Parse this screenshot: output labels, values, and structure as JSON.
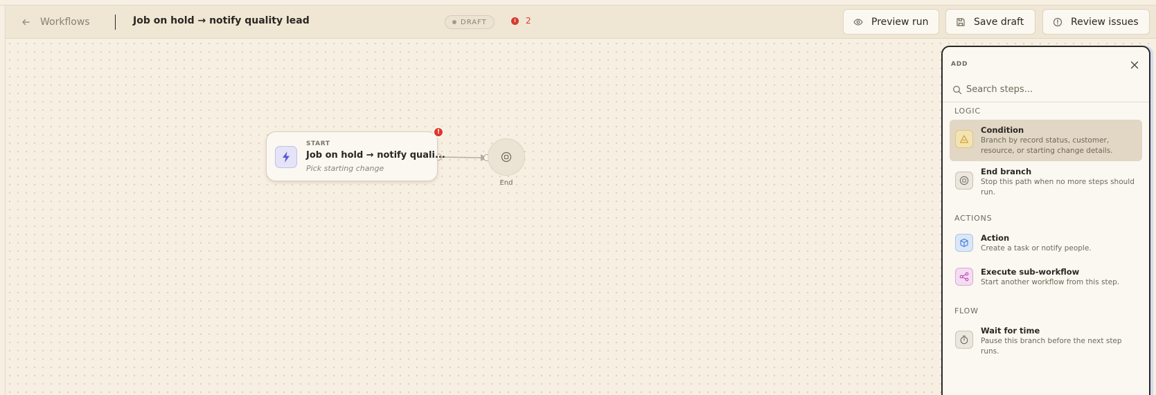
{
  "topbar": {
    "back_label": "Workflows",
    "workflow_title": "Job on hold → notify quality lead",
    "status_badge": "DRAFT",
    "issue_count": "2",
    "buttons": {
      "preview": "Preview run",
      "save": "Save draft",
      "review": "Review issues"
    }
  },
  "canvas": {
    "start_node": {
      "kicker": "START",
      "title": "Job on hold → notify quali...",
      "subtitle": "Pick starting change",
      "error_mark": "!"
    },
    "end_node": {
      "label": "End"
    }
  },
  "panel": {
    "title": "ADD",
    "search_placeholder": "Search steps...",
    "sections": [
      {
        "heading": "LOGIC",
        "items": [
          {
            "title": "Condition",
            "description": "Branch by record status, customer, resource, or starting change details.",
            "icon": "branch-triangle-icon",
            "active": true
          },
          {
            "title": "End branch",
            "description": "Stop this path when no more steps should run.",
            "icon": "stop-circle-icon",
            "active": false
          }
        ]
      },
      {
        "heading": "ACTIONS",
        "items": [
          {
            "title": "Action",
            "description": "Create a task or notify people.",
            "icon": "box-icon",
            "active": false
          },
          {
            "title": "Execute sub-workflow",
            "description": "Start another workflow from this step.",
            "icon": "share-nodes-icon",
            "active": false
          }
        ]
      },
      {
        "heading": "FLOW",
        "items": [
          {
            "title": "Wait for time",
            "description": "Pause this branch before the next step runs.",
            "icon": "timer-icon",
            "active": false
          }
        ]
      }
    ]
  },
  "colors": {
    "canvas_bg": "#f6efe2",
    "topbar_bg": "#efe6d4",
    "error": "#d63b2e",
    "active_item": "#e1d7c4",
    "trigger_accent": "#5b57d6"
  }
}
